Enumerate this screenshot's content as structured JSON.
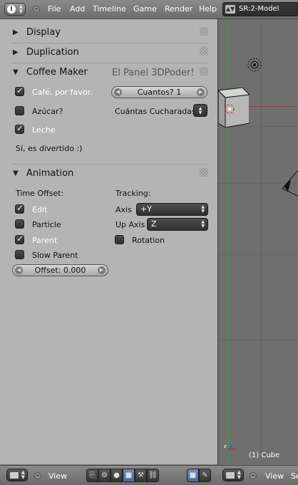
{
  "header": {
    "menus": [
      "File",
      "Add",
      "Timeline",
      "Game",
      "Render",
      "Help"
    ],
    "screen_layout": "SR:2-Model"
  },
  "panels": {
    "display": {
      "title": "Display"
    },
    "duplication": {
      "title": "Duplication"
    },
    "coffee": {
      "title": "Coffee Maker",
      "subtitle": "El Panel 3DPoder!",
      "cafe_label": "Café, por favor.",
      "cafe_checked": true,
      "cuantos": "Cuantos? 1",
      "azucar_label": "Azúcar?",
      "azucar_checked": false,
      "cucharadas_label": "Cuántas Cucharadas?",
      "leche_label": "Leche",
      "leche_checked": true,
      "divertido": "Sí, es divertido :)"
    },
    "animation": {
      "title": "Animation",
      "time_offset_label": "Time Offset:",
      "tracking_label": "Tracking:",
      "edit_label": "Edit",
      "edit_checked": true,
      "particle_label": "Particle",
      "particle_checked": false,
      "parent_label": "Parent",
      "parent_checked": true,
      "slow_parent_label": "Slow Parent",
      "slow_parent_checked": false,
      "axis_label": "Axis",
      "axis_value": "+Y",
      "up_axis_label": "Up Axis",
      "up_axis_value": "Z",
      "rotation_label": "Rotation",
      "rotation_checked": false,
      "offset": "Offset: 0.000"
    }
  },
  "viewport": {
    "object_label": "(1) Cube"
  },
  "footer": {
    "view_label_left": "View",
    "view_label_right": "View",
    "right_cut_text": "Se"
  },
  "colors": {
    "panel_bg": "#b4b4b4",
    "viewport_bg": "#6f6f6f",
    "header_bg": "#7c7c7c",
    "x_axis": "#c03030",
    "y_axis": "#40a040"
  }
}
